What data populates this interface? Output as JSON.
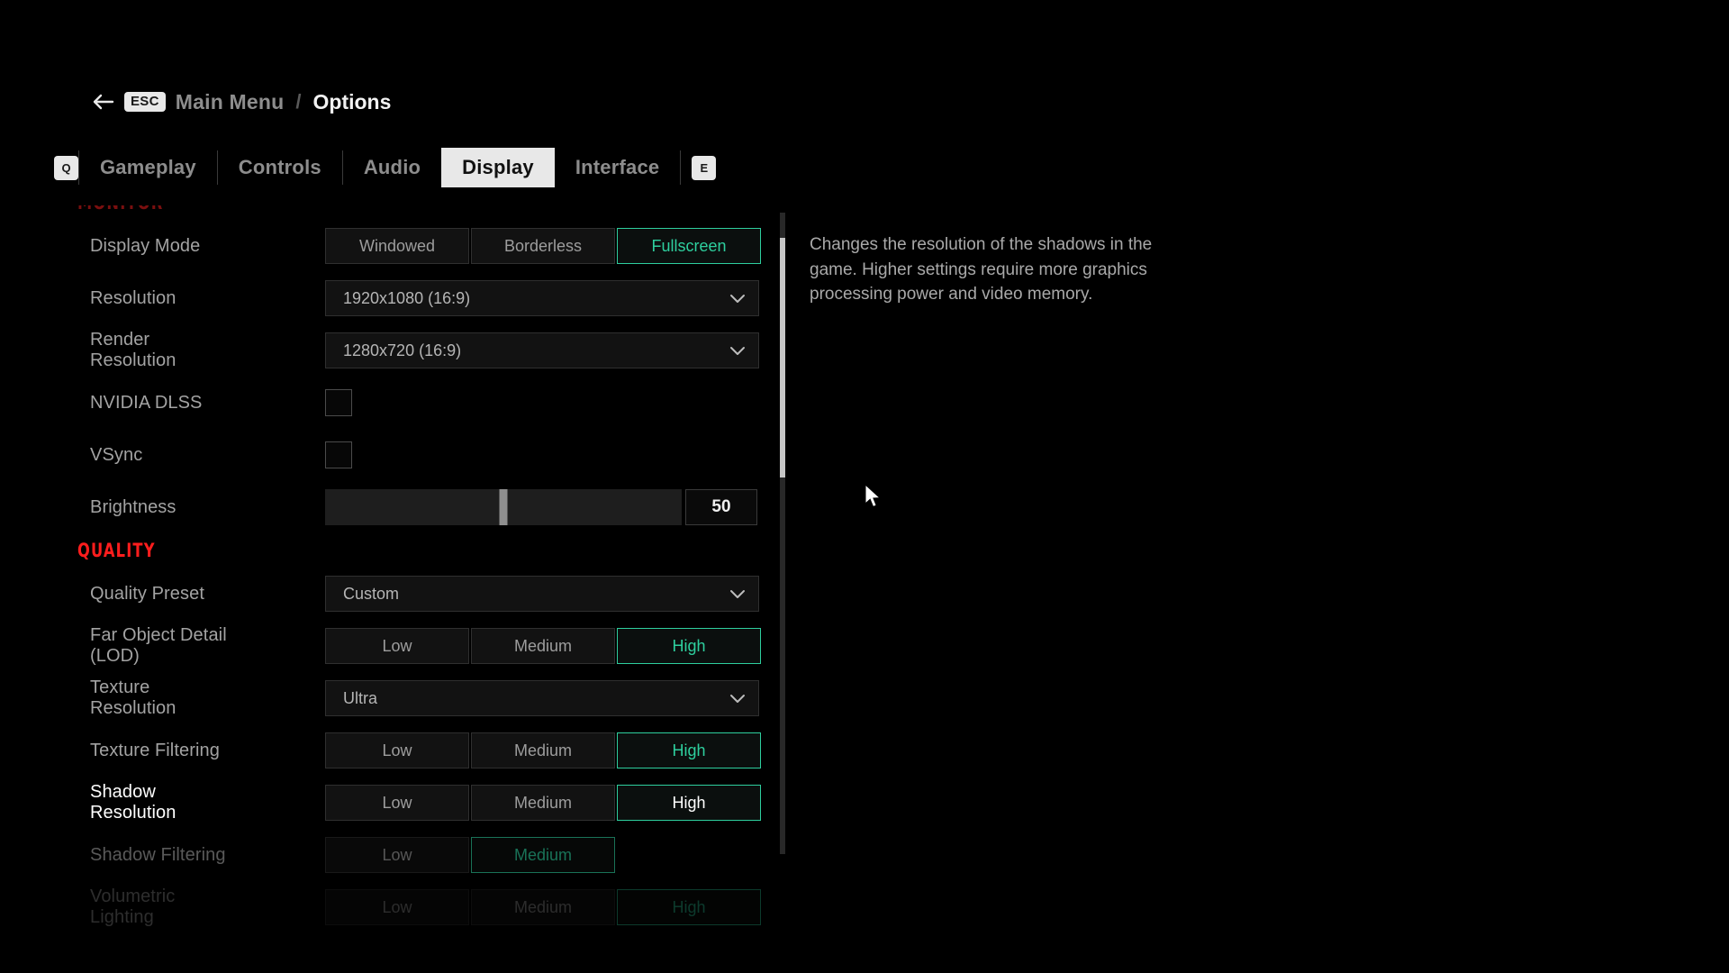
{
  "breadcrumb": {
    "back_icon": "arrow-left-icon",
    "esc_key": "ESC",
    "parent": "Main Menu",
    "separator": "/",
    "current": "Options"
  },
  "tabs": {
    "left_key": "Q",
    "right_key": "E",
    "items": [
      {
        "label": "Gameplay",
        "active": false
      },
      {
        "label": "Controls",
        "active": false
      },
      {
        "label": "Audio",
        "active": false
      },
      {
        "label": "Display",
        "active": true
      },
      {
        "label": "Interface",
        "active": false
      }
    ]
  },
  "sections": [
    {
      "title": "MONITOR",
      "rows": [
        {
          "label": "Display Mode",
          "type": "segmented",
          "options": [
            "Windowed",
            "Borderless",
            "Fullscreen"
          ],
          "selected": "Fullscreen"
        },
        {
          "label": "Resolution",
          "type": "dropdown",
          "value": "1920x1080 (16:9)"
        },
        {
          "label": "Render Resolution",
          "type": "dropdown",
          "value": "1280x720 (16:9)"
        },
        {
          "label": "NVIDIA DLSS",
          "type": "checkbox",
          "checked": false
        },
        {
          "label": "VSync",
          "type": "checkbox",
          "checked": false
        },
        {
          "label": "Brightness",
          "type": "slider",
          "value": "50",
          "percent": 50
        }
      ]
    },
    {
      "title": "QUALITY",
      "rows": [
        {
          "label": "Quality Preset",
          "type": "dropdown",
          "value": "Custom"
        },
        {
          "label": "Far Object Detail (LOD)",
          "type": "segmented",
          "options": [
            "Low",
            "Medium",
            "High"
          ],
          "selected": "High"
        },
        {
          "label": "Texture Resolution",
          "type": "dropdown",
          "value": "Ultra"
        },
        {
          "label": "Texture Filtering",
          "type": "segmented",
          "options": [
            "Low",
            "Medium",
            "High"
          ],
          "selected": "High"
        },
        {
          "label": "Shadow Resolution",
          "type": "segmented",
          "options": [
            "Low",
            "Medium",
            "High"
          ],
          "selected": "High",
          "focused": true
        },
        {
          "label": "Shadow Filtering",
          "type": "segmented",
          "options": [
            "Low",
            "Medium"
          ],
          "selected": "Medium"
        },
        {
          "label": "Volumetric Lighting",
          "type": "segmented",
          "options": [
            "Low",
            "Medium",
            "High"
          ],
          "selected": "High"
        }
      ]
    }
  ],
  "description": {
    "text": "Changes the resolution of the shadows in the game. Higher settings require more graphics processing power and video memory."
  },
  "scrollbar": {
    "thumb_top_percent": 4,
    "thumb_height_percent": 37
  },
  "colors": {
    "accent_teal": "#2ecf9e",
    "section_red": "#ff1d1d",
    "background": "#000000",
    "tab_active_bg": "#e8e8e8"
  },
  "labels": {
    "rows": {
      "display_mode": "Display Mode",
      "resolution": "Resolution",
      "render_resolution": "Render Resolution",
      "nvidia_dlss": "NVIDIA DLSS",
      "vsync": "VSync",
      "brightness": "Brightness",
      "quality_preset": "Quality Preset",
      "far_object_detail": "Far Object Detail (LOD)",
      "texture_resolution": "Texture Resolution",
      "texture_filtering": "Texture Filtering",
      "shadow_resolution": "Shadow Resolution",
      "shadow_filtering": "Shadow Filtering",
      "volumetric_lighting": "Volumetric Lighting"
    }
  }
}
